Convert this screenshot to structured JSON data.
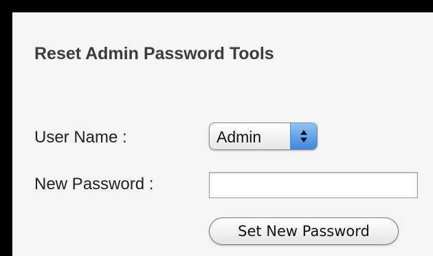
{
  "page": {
    "title": "Reset Admin Password Tools"
  },
  "form": {
    "user_name_label": "User Name :",
    "user_name_value": "Admin",
    "new_password_label": "New Password :",
    "new_password_value": "",
    "submit_label": "Set New Password"
  },
  "icons": {
    "select_arrows": "up-down-arrows-icon"
  },
  "colors": {
    "background": "#f5f5f5",
    "border": "#000000",
    "select_accent": "#3d86dd"
  }
}
